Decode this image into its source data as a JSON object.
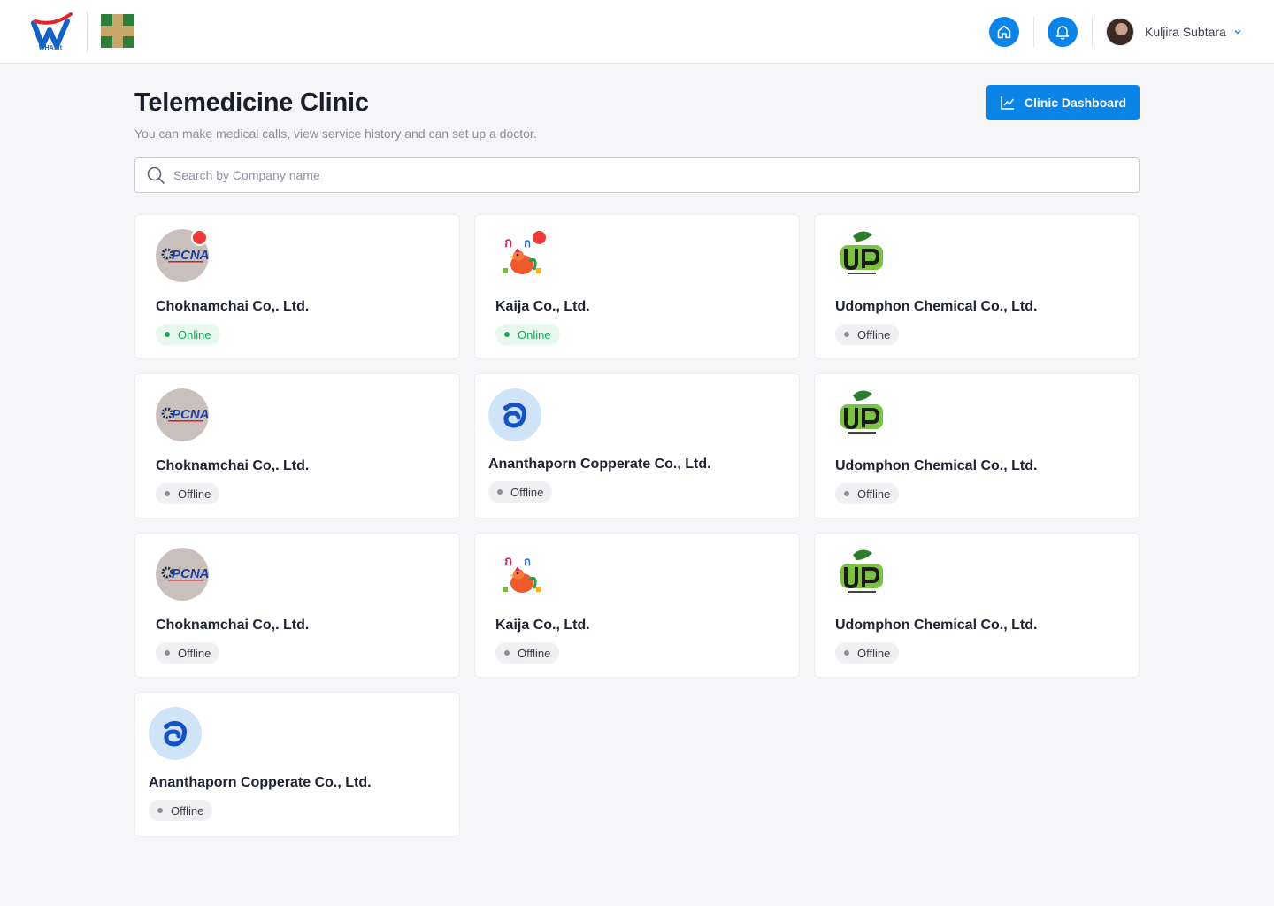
{
  "header": {
    "brand_text": "WHAbit",
    "user_name": "Kuljira Subtara",
    "icons": {
      "home": "home-icon",
      "bell": "bell-icon",
      "chevron": "chevron-down-icon"
    }
  },
  "page": {
    "title": "Telemedicine Clinic",
    "subtitle": "You can make medical calls, view service history and can set up a doctor.",
    "dashboard_button": "Clinic Dashboard"
  },
  "search": {
    "placeholder": "Search by Company name"
  },
  "colors": {
    "primary": "#0a84e6",
    "online": "#1ca555",
    "notification": "#f03a3a"
  },
  "companies": [
    {
      "name": "Choknamchai Co,. Ltd.",
      "status": "Online",
      "logo": "pcna",
      "notification": true
    },
    {
      "name": "Kaija Co., Ltd.",
      "status": "Online",
      "logo": "kaija",
      "notification": true
    },
    {
      "name": "Udomphon Chemical Co., Ltd.",
      "status": "Offline",
      "logo": "udomphon",
      "notification": false
    },
    {
      "name": "Choknamchai Co,. Ltd.",
      "status": "Offline",
      "logo": "pcna",
      "notification": false
    },
    {
      "name": "Ananthaporn Copperate Co., Ltd.",
      "status": "Offline",
      "logo": "ananthaporn",
      "notification": false
    },
    {
      "name": "Udomphon Chemical Co., Ltd.",
      "status": "Offline",
      "logo": "udomphon",
      "notification": false
    },
    {
      "name": "Choknamchai Co,. Ltd.",
      "status": "Offline",
      "logo": "pcna",
      "notification": false
    },
    {
      "name": "Kaija Co., Ltd.",
      "status": "Offline",
      "logo": "kaija",
      "notification": false
    },
    {
      "name": "Udomphon Chemical Co., Ltd.",
      "status": "Offline",
      "logo": "udomphon",
      "notification": false
    },
    {
      "name": "Ananthaporn Copperate Co., Ltd.",
      "status": "Offline",
      "logo": "ananthaporn",
      "notification": false
    }
  ]
}
